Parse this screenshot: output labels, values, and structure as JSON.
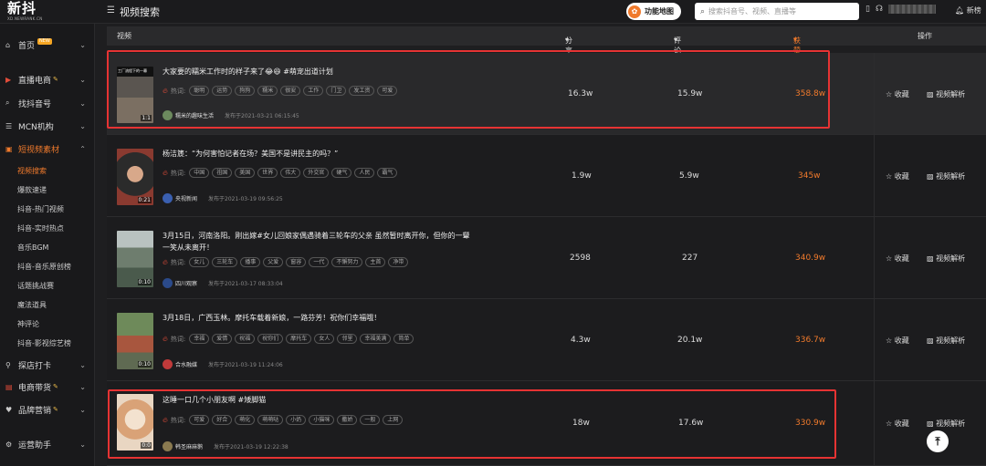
{
  "app": {
    "logo_cn": "新抖",
    "logo_en": "XD.NEWRANK.CN",
    "page_title": "视频搜索",
    "func_map_label": "功能地图",
    "search_placeholder": "搜索抖音号、视频、直播等",
    "notif_label": "新榜"
  },
  "sidebar": {
    "items": [
      {
        "label": "首页",
        "icon": "home-icon",
        "badge": "NEW"
      },
      {
        "label": "直播电商",
        "icon": "live-icon",
        "vip": true
      },
      {
        "label": "找抖音号",
        "icon": "search-account-icon"
      },
      {
        "label": "MCN机构",
        "icon": "mcn-icon"
      },
      {
        "label": "短视频素材",
        "icon": "video-material-icon"
      },
      {
        "label": "探店打卡",
        "icon": "location-icon"
      },
      {
        "label": "电商带货",
        "icon": "cart-icon",
        "vip": true
      },
      {
        "label": "品牌营销",
        "icon": "heart-icon",
        "vip": true
      },
      {
        "label": "运营助手",
        "icon": "assistant-icon"
      }
    ],
    "sub_items": [
      "视频搜索",
      "爆款速递",
      "抖音-热门视频",
      "抖音-实时热点",
      "音乐BGM",
      "抖音-音乐原创榜",
      "话题挑战赛",
      "魔法道具",
      "神评论",
      "抖音-影视综艺榜"
    ]
  },
  "table": {
    "headers": {
      "video": "视频",
      "shares": "分享数",
      "comments": "评论数",
      "likes": "获赞数",
      "ops": "操作"
    },
    "hot_label": "热词:",
    "collect_label": "收藏",
    "analyze_label": "视频解析",
    "rows": [
      {
        "thumb_text": "工厂流程下的一幕",
        "duration": "1:1",
        "title": "大家要的糯米工作时的样子来了😂😆 #萌宠出道计划",
        "tags": [
          "聪明",
          "运势",
          "狗狗",
          "糯米",
          "很安",
          "工作",
          "门卫",
          "发工资",
          "可爱"
        ],
        "author": "糯米的趣味生活",
        "published": "发布于2021-03-21 06:15:45",
        "shares": "16.3w",
        "comments": "15.9w",
        "likes": "358.8w"
      },
      {
        "thumb_text": "",
        "duration": "0:21",
        "title": "杨洁篪：“为何害怕记者在场？美国不是讲民主的吗？”",
        "tags": [
          "中国",
          "祖国",
          "美国",
          "世界",
          "伟大",
          "外交官",
          "硬气",
          "人民",
          "霸气"
        ],
        "author": "央视新闻",
        "published": "发布于2021-03-19 09:56:25",
        "shares": "1.9w",
        "comments": "5.9w",
        "likes": "345w"
      },
      {
        "thumb_text": "",
        "duration": "0:10",
        "title": "3月15日，河南洛阳。刚出嫁#女儿回娘家偶遇骑着三轮车的父亲 虽然暂时离开你，但你的一颦一笑从未离开！",
        "tags": [
          "女儿",
          "三轮车",
          "播事",
          "父爱",
          "窗容",
          "一代",
          "不懈努力",
          "主首",
          "净带"
        ],
        "author": "四川观察",
        "published": "发布于2021-03-17 08:33:04",
        "shares": "2598",
        "comments": "227",
        "likes": "340.9w"
      },
      {
        "thumb_text": "",
        "duration": "0:10",
        "title": "3月18日，广西玉林。摩托车载着新娘，一路芬芳！祝你们幸福哦！",
        "tags": [
          "幸福",
          "爱情",
          "祝福",
          "祝你们",
          "摩托车",
          "女人",
          "邻里",
          "幸福美满",
          "简单"
        ],
        "author": "合水融媒",
        "published": "发布于2021-03-19 11:24:06",
        "shares": "4.3w",
        "comments": "20.1w",
        "likes": "336.7w"
      },
      {
        "thumb_text": "",
        "duration": "0:0",
        "title": "这睡一口几个小朋友啊 #矮脚猫",
        "tags": [
          "可爱",
          "好合",
          "萌化",
          "萌萌哒",
          "小奶",
          "小猫咪",
          "撒娇",
          "一般",
          "上网"
        ],
        "author": "韩圣麻麻鹅",
        "published": "发布于2021-03-19 12:22:38",
        "shares": "18w",
        "comments": "17.6w",
        "likes": "330.9w"
      }
    ]
  },
  "colors": {
    "accent": "#f07a2c",
    "highlight_box": "#e63333"
  }
}
